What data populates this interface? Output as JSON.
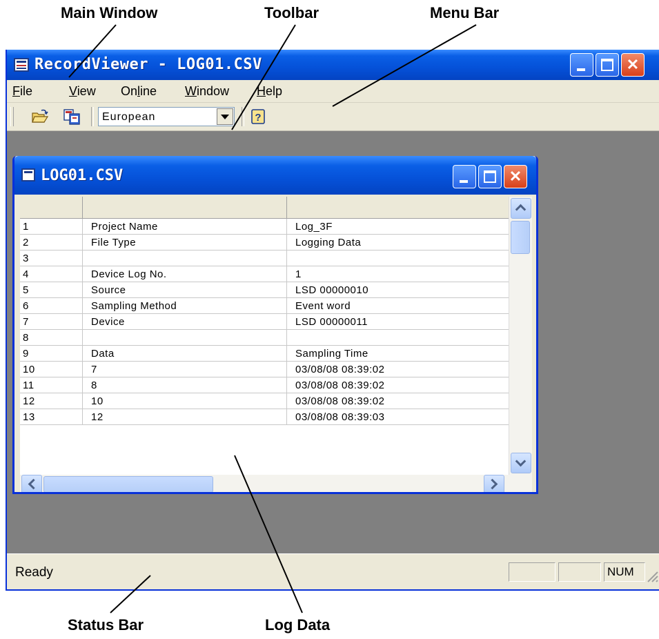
{
  "callouts": {
    "main_window": "Main Window",
    "toolbar": "Toolbar",
    "menu_bar": "Menu Bar",
    "status_bar": "Status Bar",
    "log_data": "Log Data"
  },
  "app": {
    "title": "RecordViewer - LOG01.CSV"
  },
  "menu": {
    "file": {
      "label": "File",
      "underline": "F",
      "rest": "ile"
    },
    "view": {
      "label": "View",
      "underline": "V",
      "rest": "iew"
    },
    "online": {
      "label": "Online",
      "pre": "On",
      "underline": "l",
      "rest": "ine"
    },
    "window": {
      "label": "Window",
      "underline": "W",
      "rest": "indow"
    },
    "help": {
      "label": "Help",
      "underline": "H",
      "rest": "elp"
    }
  },
  "toolbar": {
    "open_icon": "open-folder-icon",
    "convert_icon": "convert-icon",
    "format_selected": "European",
    "help_icon": "help-icon"
  },
  "child": {
    "title": "LOG01.CSV"
  },
  "log_table": {
    "rows": [
      [
        "1",
        "Project Name",
        "Log_3F"
      ],
      [
        "2",
        "File Type",
        "Logging Data"
      ],
      [
        "3",
        "",
        ""
      ],
      [
        "4",
        "Device Log No.",
        "1"
      ],
      [
        "5",
        "Source",
        "LSD 00000010"
      ],
      [
        "6",
        "Sampling Method",
        "Event word"
      ],
      [
        "7",
        "Device",
        "LSD 00000011"
      ],
      [
        "8",
        "",
        ""
      ],
      [
        "9",
        "Data",
        "Sampling Time"
      ],
      [
        "10",
        "7",
        " 03/08/08 08:39:02"
      ],
      [
        "11",
        "8",
        " 03/08/08 08:39:02"
      ],
      [
        "12",
        "10",
        " 03/08/08 08:39:02"
      ],
      [
        "13",
        "12",
        " 03/08/08 08:39:03"
      ]
    ]
  },
  "status": {
    "text": "Ready",
    "num": "NUM"
  },
  "colors": {
    "titlebar": "#0551d8",
    "chrome": "#ece9d8",
    "mdi_background": "#808080",
    "close_button": "#d8401a"
  }
}
